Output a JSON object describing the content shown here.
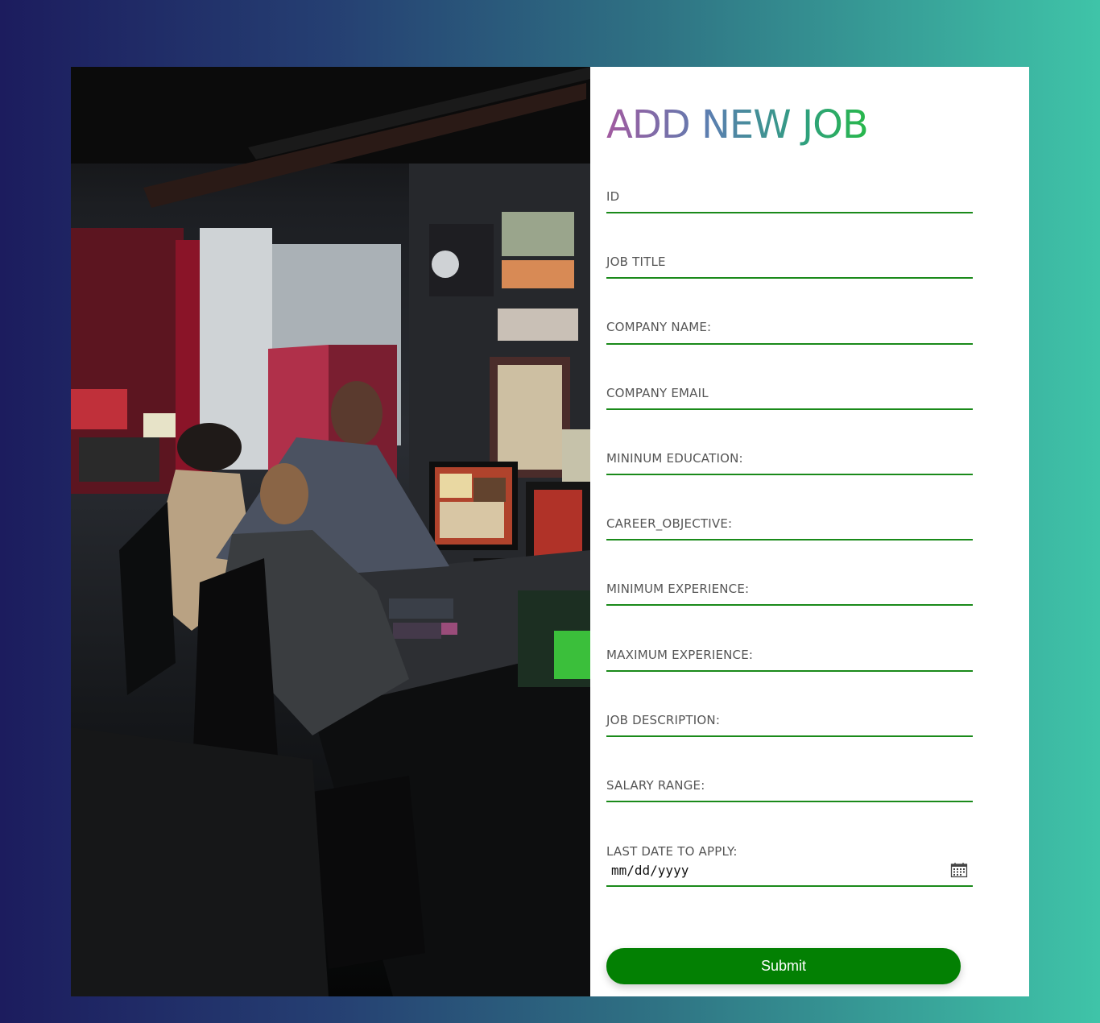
{
  "form": {
    "title": "ADD NEW JOB",
    "fields": [
      {
        "label": "ID",
        "value": ""
      },
      {
        "label": "JOB TITLE",
        "value": ""
      },
      {
        "label": "COMPANY NAME:",
        "value": ""
      },
      {
        "label": "COMPANY EMAIL",
        "value": ""
      },
      {
        "label": "MININUM EDUCATION:",
        "value": ""
      },
      {
        "label": "CAREER_OBJECTIVE:",
        "value": ""
      },
      {
        "label": "MINIMUM EXPERIENCE:",
        "value": ""
      },
      {
        "label": "MAXIMUM EXPERIENCE:",
        "value": ""
      },
      {
        "label": "JOB DESCRIPTION:",
        "value": ""
      },
      {
        "label": "SALARY RANGE:",
        "value": ""
      }
    ],
    "date_field": {
      "label": "LAST DATE TO APPLY:",
      "placeholder": "mm/dd/yyyy",
      "icon": "calendar-icon"
    },
    "submit_label": "Submit"
  },
  "colors": {
    "accent_green": "#038003",
    "underline": "#1a8a1a"
  }
}
